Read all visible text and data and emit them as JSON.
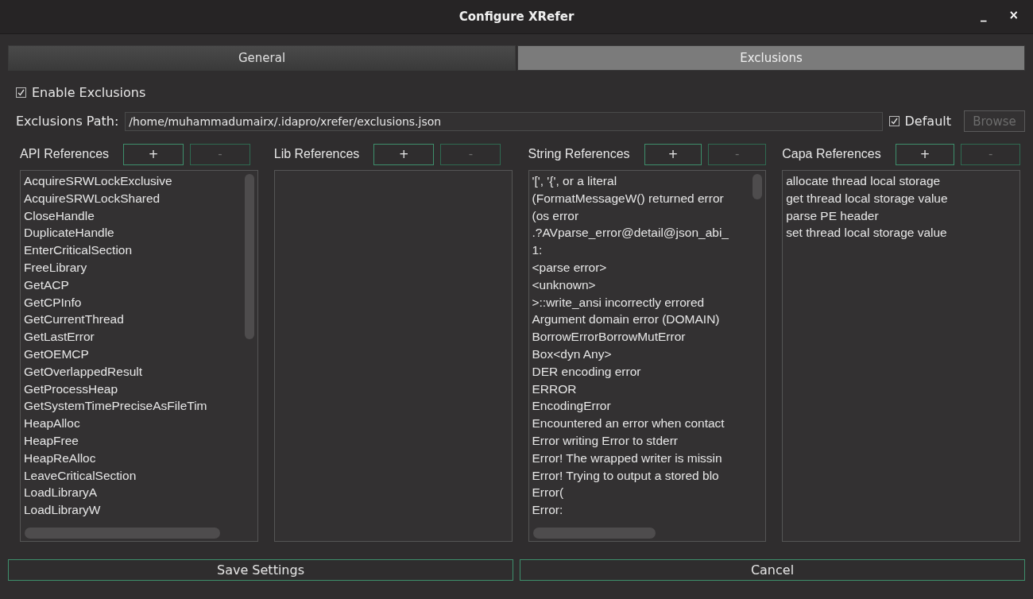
{
  "window": {
    "title": "Configure XRefer",
    "controls": [
      "_",
      "×"
    ]
  },
  "tabs": [
    {
      "label": "General",
      "selected": false
    },
    {
      "label": "Exclusions",
      "selected": true
    }
  ],
  "enable_exclusions": {
    "label": "Enable Exclusions",
    "checked": true
  },
  "path": {
    "label": "Exclusions Path:",
    "value": "/home/muhammadumairx/.idapro/xrefer/exclusions.json",
    "default": {
      "label": "Default",
      "checked": true
    },
    "browse": {
      "label": "Browse",
      "disabled": true
    }
  },
  "panels": [
    {
      "title": "API References",
      "add": {
        "label": "+",
        "disabled": false
      },
      "remove": {
        "label": "-",
        "disabled": true
      },
      "scrollbars": true,
      "items": [
        "AcquireSRWLockExclusive",
        "AcquireSRWLockShared",
        "CloseHandle",
        "DuplicateHandle",
        "EnterCriticalSection",
        "FreeLibrary",
        "GetACP",
        "GetCPInfo",
        "GetCurrentThread",
        "GetLastError",
        "GetOEMCP",
        "GetOverlappedResult",
        "GetProcessHeap",
        "GetSystemTimePreciseAsFileTim",
        "HeapAlloc",
        "HeapFree",
        "HeapReAlloc",
        "LeaveCriticalSection",
        "LoadLibraryA",
        "LoadLibraryW"
      ]
    },
    {
      "title": "Lib References",
      "add": {
        "label": "+",
        "disabled": false
      },
      "remove": {
        "label": "-",
        "disabled": true
      },
      "scrollbars": false
    },
    {
      "title": "String References",
      "add": {
        "label": "+",
        "disabled": false
      },
      "remove": {
        "label": "-",
        "disabled": true
      },
      "scrollbars": true,
      "items": [
        "'[', '{', or a literal",
        "(FormatMessageW() returned error",
        "(os error",
        ".?AVparse_error@detail@json_abi_",
        "1:",
        "<parse error>",
        "<unknown>",
        ">::write_ansi incorrectly errored",
        "Argument domain error (DOMAIN)",
        "BorrowErrorBorrowMutError",
        "Box<dyn Any>",
        "DER encoding error",
        "ERROR",
        "EncodingError",
        "Encountered an error when contact",
        "Error writing Error to stderr",
        "Error! The wrapped writer is missin",
        "Error! Trying to output a stored blo",
        "Error(",
        "Error:"
      ]
    },
    {
      "title": "Capa References",
      "add": {
        "label": "+",
        "disabled": false
      },
      "remove": {
        "label": "-",
        "disabled": true
      },
      "scrollbars": false,
      "items": [
        "allocate thread local storage",
        "get thread local storage value",
        "parse PE header",
        "set thread local storage value"
      ]
    }
  ],
  "buttons": [
    "Save Settings",
    "Cancel"
  ]
}
